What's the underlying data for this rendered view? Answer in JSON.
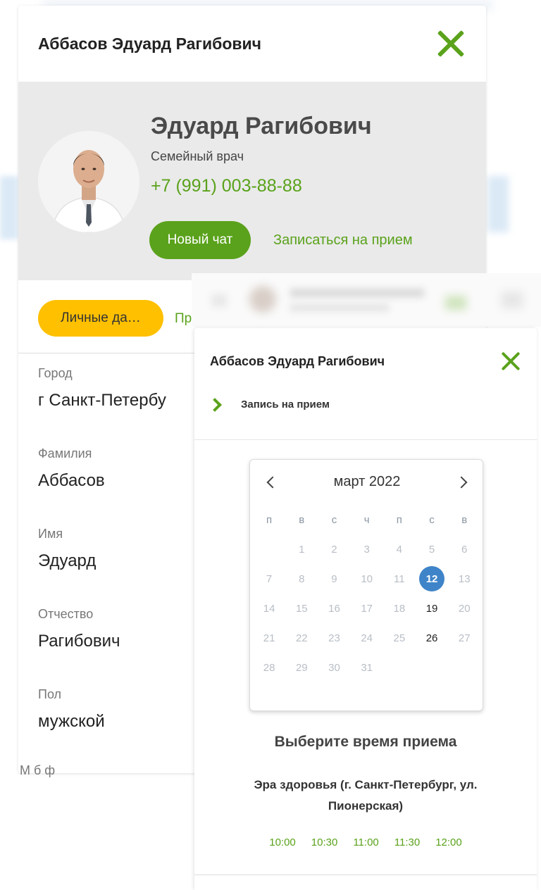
{
  "card": {
    "title": "Аббасов Эдуард Рагибович",
    "doctor": {
      "name": "Эдуард Рагибович",
      "role": "Семейный врач",
      "phone": "+7 (991) 003-88-88"
    },
    "new_chat_label": "Новый чат",
    "appointment_link": "Записаться на прием",
    "tabs": [
      "Личные да…",
      "Пр"
    ],
    "fields": [
      {
        "label": "Город",
        "value": "г Санкт-Петербу"
      },
      {
        "label": "Фамилия",
        "value": "Аббасов"
      },
      {
        "label": "Имя",
        "value": "Эдуард"
      },
      {
        "label": "Отчество",
        "value": "Рагибович"
      },
      {
        "label": "Пол",
        "value": "мужской"
      }
    ],
    "partial_label": "М б   ф"
  },
  "modal": {
    "title": "Аббасов Эдуард Рагибович",
    "breadcrumb": "Запись на прием",
    "calendar": {
      "month": "март 2022",
      "weekdays": [
        "п",
        "в",
        "с",
        "ч",
        "п",
        "с",
        "в"
      ],
      "days": [
        [
          "",
          "1",
          "2",
          "3",
          "4",
          "5",
          "6"
        ],
        [
          "7",
          "8",
          "9",
          "10",
          "11",
          "12",
          "13"
        ],
        [
          "14",
          "15",
          "16",
          "17",
          "18",
          "19",
          "20"
        ],
        [
          "21",
          "22",
          "23",
          "24",
          "25",
          "26",
          "27"
        ],
        [
          "28",
          "29",
          "30",
          "31",
          "",
          "",
          ""
        ]
      ],
      "selected_day": "12",
      "available_days": [
        "19",
        "26"
      ]
    },
    "choose_time": "Выберите время приема",
    "clinic": "Эра здоровья (г. Санкт-Петербург, ул. Пионерская)",
    "slots": [
      "10:00",
      "10:30",
      "11:00",
      "11:30",
      "12:00"
    ]
  },
  "colors": {
    "accent_green": "#5aa21b",
    "tab_yellow": "#ffc000",
    "selected_blue": "#3f84c8",
    "profile_bg": "#eaeaea"
  }
}
